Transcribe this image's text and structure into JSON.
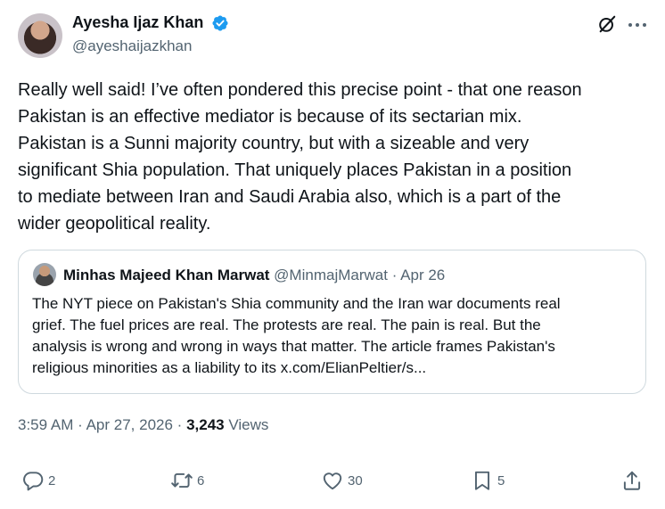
{
  "author": {
    "name": "Ayesha Ijaz Khan",
    "handle": "@ayeshaijazkhan",
    "verified_color": "#1d9bf0"
  },
  "tweet": {
    "text": "Really well said! I’ve often pondered this precise point - that one reason\nPakistan is an effective mediator is because of its sectarian mix.\nPakistan is a Sunni majority country, but with a sizeable and very\nsignificant Shia population. That uniquely places Pakistan in a position\nto mediate between Iran and Saudi Arabia also, which is a part of the\nwider geopolitical reality."
  },
  "quote": {
    "name": "Minhas Majeed Khan Marwat",
    "handle": "@MinmajMarwat",
    "separator": "·",
    "date": "Apr 26",
    "text": "The NYT piece on Pakistan's Shia community and the Iran war documents real\ngrief. The fuel prices are real. The protests are real. The pain is real. But the\nanalysis is wrong and wrong in ways that matter. The article frames Pakistan's\nreligious minorities as a liability to its x.com/ElianPeltier/s..."
  },
  "meta": {
    "time": "3:59 AM",
    "separator": "·",
    "date": "Apr 27, 2026",
    "views_count": "3,243",
    "views_label": "Views"
  },
  "actions": {
    "replies": "2",
    "reposts": "6",
    "likes": "30",
    "bookmarks": "5"
  },
  "icons": [
    "verified-icon",
    "grok-icon",
    "more-icon",
    "reply-icon",
    "retweet-icon",
    "like-icon",
    "bookmark-icon",
    "share-icon"
  ]
}
